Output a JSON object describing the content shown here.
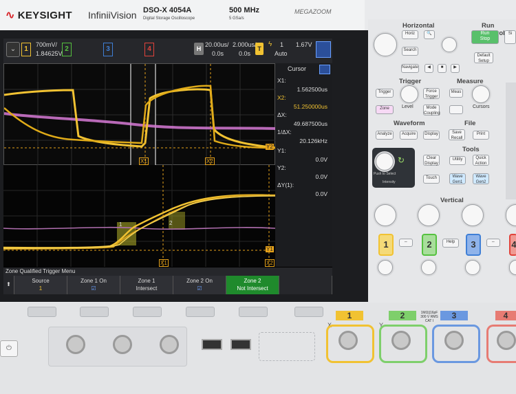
{
  "brand": {
    "name": "KEYSIGHT",
    "series": "InfiniiVision",
    "model": "DSO-X 4054A",
    "model_sub": "Digital Storage Oscilloscope",
    "bandwidth": "500 MHz",
    "sample_rate": "5 GSa/s",
    "megazoom": "MEGAZOOM"
  },
  "status": {
    "ch1_scale": "700mV/",
    "ch1_offset": "1.84625V",
    "channels": [
      "1",
      "2",
      "3",
      "4"
    ],
    "h_label": "H",
    "time_div": "20.00us/",
    "zoom_div": "2.000us/",
    "delay1": "0.0s",
    "delay2": "0.0s",
    "trig_label": "T",
    "trig_source": "1",
    "trig_level": "1.67V",
    "trig_mode": "Auto"
  },
  "cursor_panel": {
    "title": "Cursor",
    "rows": [
      {
        "label": "X1:",
        "value": "1.562500us"
      },
      {
        "label": "X2:",
        "value": "51.250000us"
      },
      {
        "label": "ΔX:",
        "value": "49.687500us"
      },
      {
        "label": "1/ΔX:",
        "value": "20.126kHz"
      },
      {
        "label": "Y1:",
        "value": "0.0V"
      },
      {
        "label": "Y2:",
        "value": "0.0V"
      },
      {
        "label": "ΔY(1):",
        "value": "0.0V"
      }
    ]
  },
  "markers": {
    "x1": "X1",
    "x2": "X2",
    "y1": "Y1",
    "y2": "Y2",
    "zone1": "1",
    "zone2": "2"
  },
  "menu": {
    "title": "Zone Qualified Trigger Menu",
    "keys": [
      {
        "l1": "Source",
        "l2": "1"
      },
      {
        "l1": "Zone 1 On",
        "l2": "☑"
      },
      {
        "l1": "Zone 1",
        "l2": "Intersect"
      },
      {
        "l1": "Zone 2 On",
        "l2": "☑"
      },
      {
        "l1": "Zone 2",
        "l2": "Not Intersect"
      }
    ]
  },
  "panel": {
    "horizontal": "Horizontal",
    "horiz_btn": "Horiz",
    "search_btn": "Search",
    "navigate_btn": "Navigate",
    "run_control": "Run Control",
    "run_stop": "Run\nStop",
    "single": "Si",
    "default_setup": "Default\nSetup",
    "trigger": "Trigger",
    "trigger_btn": "Trigger",
    "force_trigger": "Force\nTrigger",
    "zone_btn": "Zone",
    "level": "Level",
    "mode_coupling": "Mode\nCoupling",
    "measure": "Measure",
    "meas_btn": "Meas",
    "cursors": "Cursors",
    "waveform": "Waveform",
    "analyze": "Analyze",
    "acquire": "Acquire",
    "display": "Display",
    "file": "File",
    "save_recall": "Save\nRecall",
    "print": "Print",
    "tools": "Tools",
    "clear_display": "Clear\nDisplay",
    "utility": "Utility",
    "quick_action": "Quick\nAction",
    "touch": "Touch",
    "wavegen1": "Wave\nGen1",
    "wavegen2": "Wave\nGen2",
    "push_select": "Push to Select",
    "intensity": "Intensity",
    "vertical": "Vertical",
    "help": "Help",
    "ch_keys": [
      "1",
      "2",
      "3",
      "4"
    ],
    "input_spec": "1MΩ||16pF\n300 V RMS\nCAT I",
    "axis_x": "X",
    "axis_y": "Y"
  },
  "colors": {
    "ch1": "#f1c232",
    "ch2": "#55c13f",
    "ch3": "#3f7fd6",
    "ch4": "#e2433b",
    "zone": "#b7b52a",
    "active_key": "#1f8a2c",
    "pink": "#d77ad6"
  }
}
